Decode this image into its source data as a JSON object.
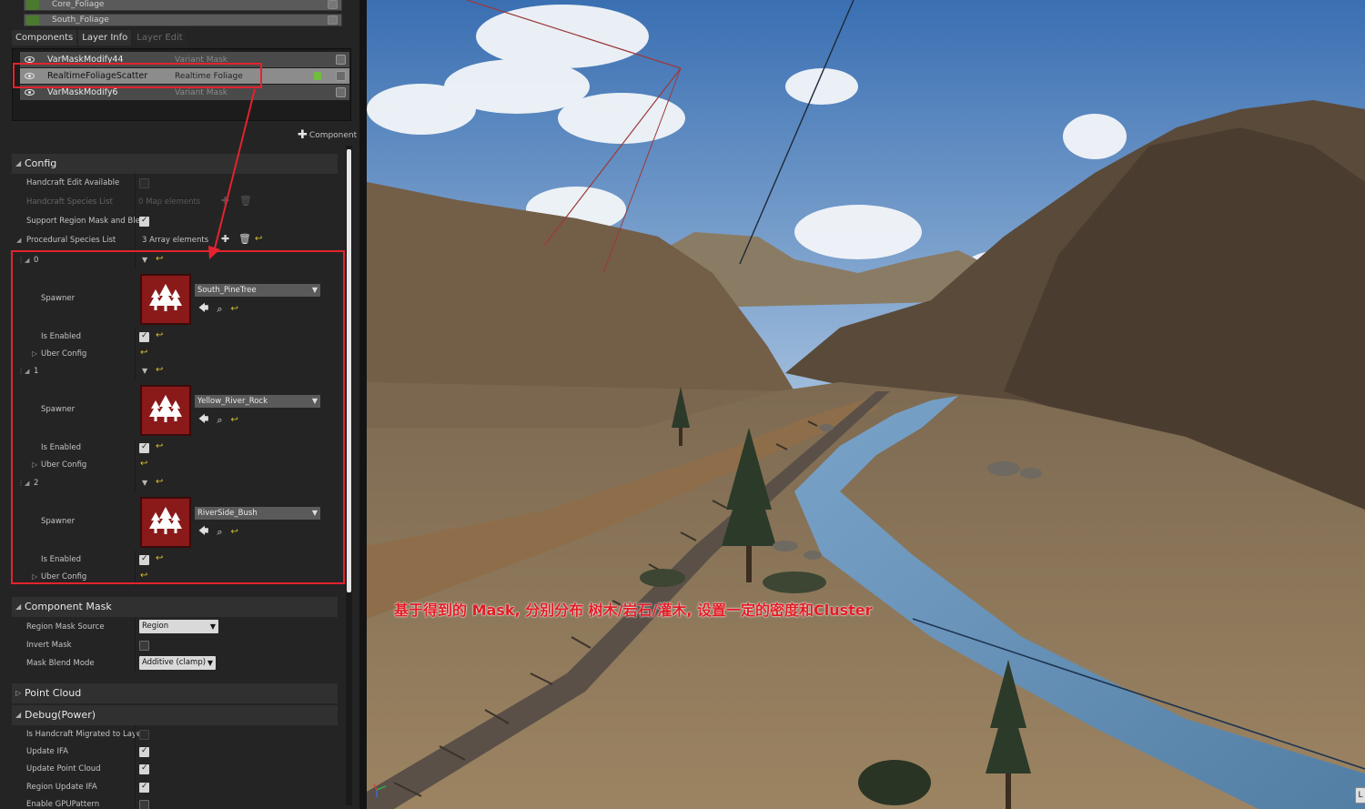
{
  "layers_top": [
    "Core_Foliage",
    "South_Foliage"
  ],
  "tabs": [
    {
      "label": "Components",
      "active": true
    },
    {
      "label": "Layer Info",
      "active": false
    },
    {
      "label": "Layer Edit",
      "active": false,
      "disabled": true
    }
  ],
  "components": [
    {
      "name": "VarMaskModify44",
      "type": "Variant Mask",
      "selected": false
    },
    {
      "name": "RealtimeFoliageScatter",
      "type": "Realtime Foliage",
      "selected": true
    },
    {
      "name": "VarMaskModify6",
      "type": "Variant Mask",
      "selected": false
    }
  ],
  "add_component_label": "Component",
  "config": {
    "title": "Config",
    "handcraft_edit_available": {
      "label": "Handcraft Edit Available",
      "checked": false
    },
    "handcraft_species_list": {
      "label": "Handcraft Species List",
      "value": "0 Map elements"
    },
    "support_region_mask": {
      "label": "Support Region Mask and Blen",
      "checked": true
    },
    "procedural_species_list": {
      "label": "Procedural Species List",
      "value": "3 Array elements"
    },
    "species": [
      {
        "index": "0",
        "spawner_label": "Spawner",
        "asset": "South_PineTree",
        "is_enabled_label": "Is Enabled",
        "enabled": true,
        "uber_config_label": "Uber Config"
      },
      {
        "index": "1",
        "spawner_label": "Spawner",
        "asset": "Yellow_River_Rock",
        "is_enabled_label": "Is Enabled",
        "enabled": true,
        "uber_config_label": "Uber Config"
      },
      {
        "index": "2",
        "spawner_label": "Spawner",
        "asset": "RiverSide_Bush",
        "is_enabled_label": "Is Enabled",
        "enabled": true,
        "uber_config_label": "Uber Config"
      }
    ]
  },
  "component_mask": {
    "title": "Component Mask",
    "region_mask_source": {
      "label": "Region Mask Source",
      "value": "Region"
    },
    "invert_mask": {
      "label": "Invert Mask",
      "checked": false
    },
    "mask_blend_mode": {
      "label": "Mask Blend Mode",
      "value": "Additive (clamp)"
    }
  },
  "point_cloud": {
    "title": "Point Cloud"
  },
  "debug": {
    "title": "Debug(Power)",
    "items": [
      {
        "label": "Is Handcraft Migrated to Layer",
        "checked": false
      },
      {
        "label": "Update IFA",
        "checked": true
      },
      {
        "label": "Update Point Cloud",
        "checked": true
      },
      {
        "label": "Region Update IFA",
        "checked": true
      },
      {
        "label": "Enable GPUPattern",
        "checked": false
      }
    ]
  },
  "viewport": {
    "caption": "基于得到的 Mask, 分别分布 树木/岩石/灌木, 设置一定的密度和Cluster",
    "corner_label": "L"
  },
  "colors": {
    "annotation_red": "#e4232e",
    "panel_bg": "#242424",
    "selected_row": "#8c8c8c",
    "spawner_thumb": "#8a1a1a"
  }
}
